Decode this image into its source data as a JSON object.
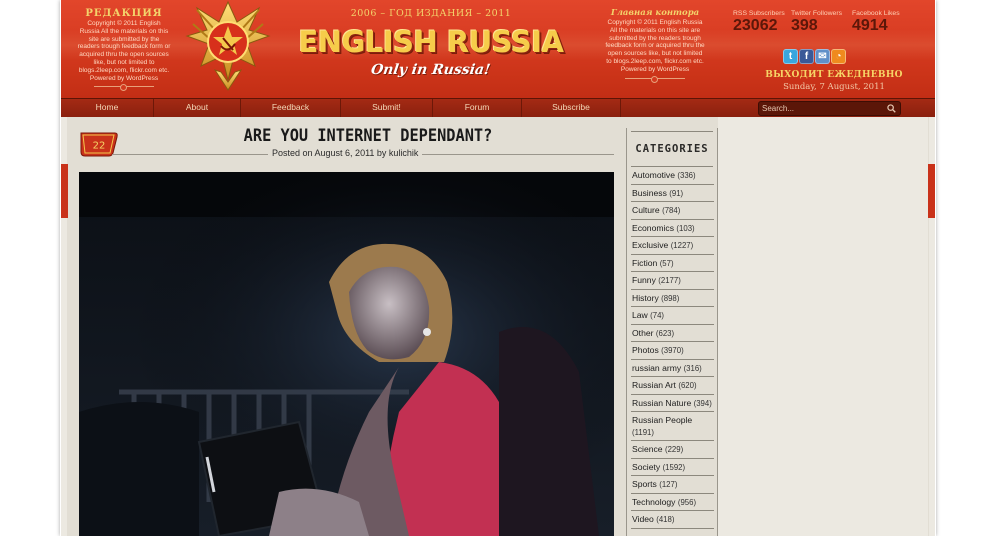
{
  "header": {
    "left_title": "РЕДАКЦИЯ",
    "left_note": "Copyright © 2011 English Russia All the materials on this site are submitted by the readers trough feedback form or acquired thru the open sources like, but not limited to blogs.2leep.com, flickr.com etc. Powered by WordPress",
    "years": "2006 – ГОД ИЗДАНИЯ – 2011",
    "logo": "ENGLISH RUSSIA",
    "slogan": "Only in Russia!",
    "right_title": "Главная контора",
    "right_note": "Copyright © 2011 English Russia All the materials on this site are submitted by the readers trough feedback form or acquired thru the open sources like, but not limited to blogs.2leep.com, flickr.com etc. Powered by WordPress",
    "stats": [
      {
        "label": "RSS Subscribers",
        "value": "23062"
      },
      {
        "label": "Twitter Followers",
        "value": "398"
      },
      {
        "label": "Facebook Likes",
        "value": "4914"
      }
    ],
    "tagline": "ВЫХОДИТ ЕЖЕДНЕВНО",
    "date": "Sunday, 7 August, 2011",
    "colors": {
      "header_red": "#d83c22",
      "gold": "#f6cc4a",
      "nav": "#8a200e"
    }
  },
  "social": [
    "twitter-icon",
    "facebook-icon",
    "email-icon",
    "rss-icon"
  ],
  "nav": {
    "items": [
      "Home",
      "About",
      "Feedback",
      "Submit!",
      "Forum",
      "Subscribe"
    ],
    "search_placeholder": "Search..."
  },
  "post": {
    "comment_count": "22",
    "title": "Are You Internet Dependant?",
    "posted_on": "Posted on August 6, 2011 by kulichik"
  },
  "sidebar": {
    "heading": "CATEGORIES",
    "categories": [
      {
        "name": "Automotive",
        "count": "(336)"
      },
      {
        "name": "Business",
        "count": "(91)"
      },
      {
        "name": "Culture",
        "count": "(784)"
      },
      {
        "name": "Economics",
        "count": "(103)"
      },
      {
        "name": "Exclusive",
        "count": "(1227)"
      },
      {
        "name": "Fiction",
        "count": "(57)"
      },
      {
        "name": "Funny",
        "count": "(2177)"
      },
      {
        "name": "History",
        "count": "(898)"
      },
      {
        "name": "Law",
        "count": "(74)"
      },
      {
        "name": "Other",
        "count": "(623)"
      },
      {
        "name": "Photos",
        "count": "(3970)"
      },
      {
        "name": "russian army",
        "count": "(316)"
      },
      {
        "name": "Russian Art",
        "count": "(620)"
      },
      {
        "name": "Russian Nature",
        "count": "(394)"
      },
      {
        "name": "Russian People",
        "count": "(1191)"
      },
      {
        "name": "Science",
        "count": "(229)"
      },
      {
        "name": "Society",
        "count": "(1592)"
      },
      {
        "name": "Sports",
        "count": "(127)"
      },
      {
        "name": "Technology",
        "count": "(956)"
      },
      {
        "name": "Video",
        "count": "(418)"
      }
    ]
  }
}
